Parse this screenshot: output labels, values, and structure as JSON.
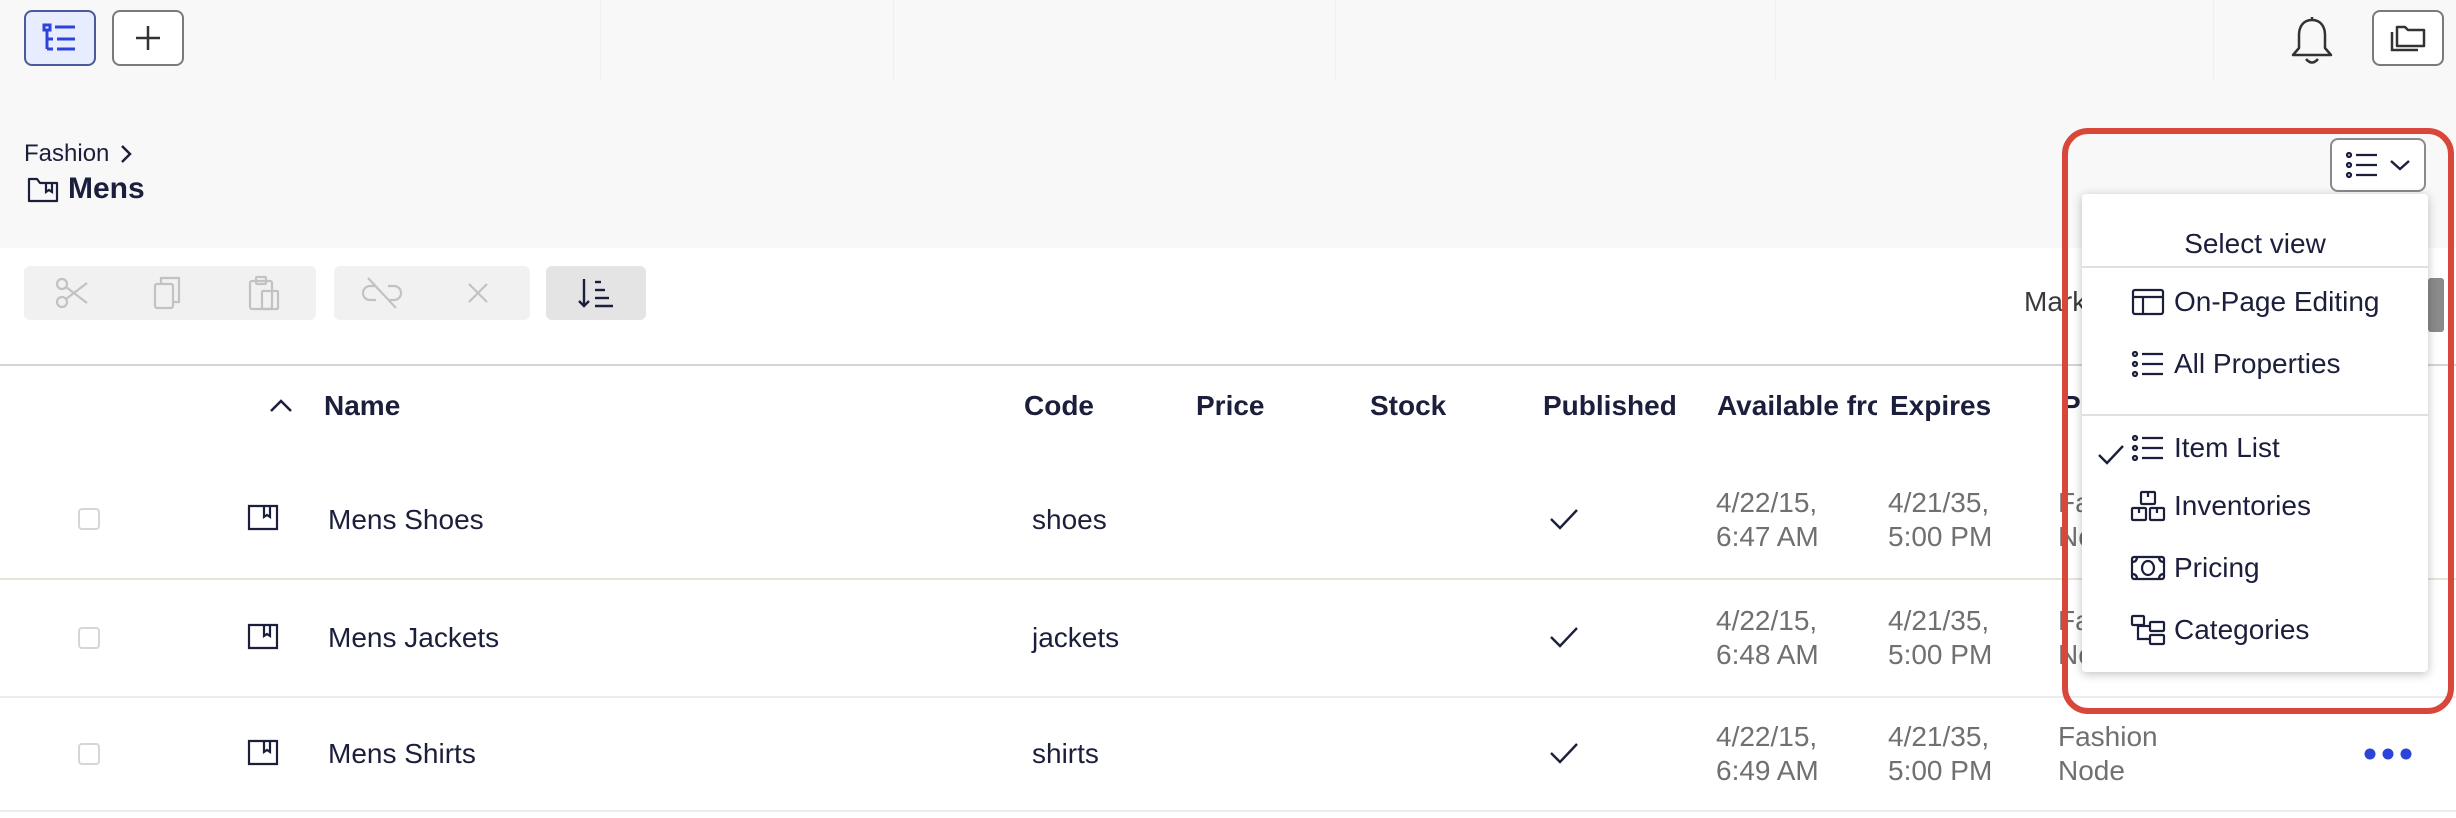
{
  "breadcrumb": {
    "parent": "Fashion"
  },
  "page": {
    "title": "Mens"
  },
  "toolbar": {
    "partial_label": "Mark"
  },
  "table": {
    "columns": [
      "Name",
      "Code",
      "Price",
      "Stock",
      "Published",
      "Available fro",
      "Expires",
      "P"
    ],
    "rows": [
      {
        "name": "Mens Shoes",
        "code": "shoes",
        "available_date": "4/22/15,",
        "available_time": "6:47 AM",
        "expires_date": "4/21/35,",
        "expires_time": "5:00 PM",
        "parent_line1": "Fa",
        "parent_line2": "No"
      },
      {
        "name": "Mens Jackets",
        "code": "jackets",
        "available_date": "4/22/15,",
        "available_time": "6:48 AM",
        "expires_date": "4/21/35,",
        "expires_time": "5:00 PM",
        "parent_line1": "Fa",
        "parent_line2": "No"
      },
      {
        "name": "Mens Shirts",
        "code": "shirts",
        "available_date": "4/22/15,",
        "available_time": "6:49 AM",
        "expires_date": "4/21/35,",
        "expires_time": "5:00 PM",
        "parent_line1": "Fashion",
        "parent_line2": "Node"
      }
    ]
  },
  "view_menu": {
    "title": "Select view",
    "items": [
      {
        "label": "On-Page Editing",
        "icon": "layout-icon"
      },
      {
        "label": "All Properties",
        "icon": "list-icon"
      },
      {
        "label": "Item List",
        "icon": "list-icon",
        "selected": true
      },
      {
        "label": "Inventories",
        "icon": "boxes-icon"
      },
      {
        "label": "Pricing",
        "icon": "money-icon"
      },
      {
        "label": "Categories",
        "icon": "tree-icon"
      }
    ]
  },
  "colors": {
    "accent": "#2b44d9",
    "highlight": "#d9463a",
    "check": "#1b1f3b"
  }
}
